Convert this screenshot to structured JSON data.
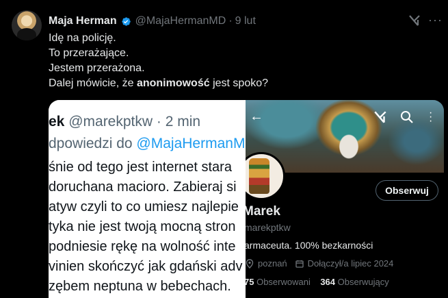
{
  "tweet": {
    "author_name": "Maja Herman",
    "handle": "@MajaHermanMD",
    "separator": "·",
    "date": "9 lut",
    "lines": [
      "Idę na policję.",
      "To przerażające.",
      "Jestem przerażona."
    ],
    "last_line_before": "Dalej mówicie, że ",
    "last_line_bold": "anonimowość",
    "last_line_after": " jest spoko?"
  },
  "left_screenshot": {
    "name": "ek",
    "handle": "@marekptkw",
    "separator": "·",
    "time": "2 min",
    "reply_prefix": "dpowiedzi do ",
    "reply_target": "@MajaHermanM",
    "body_lines": [
      "śnie od tego jest internet stara",
      "doruchana macioro. Zabieraj si",
      "atyw czyli to co umiesz najlepie",
      "tyka nie jest twoją mocną stron",
      "podniesie rękę na wolność inte",
      "vinien skończyć jak gdański adv",
      "zębem neptuna w bebechach."
    ]
  },
  "right_screenshot": {
    "follow_label": "Obserwuj",
    "name": "Marek",
    "handle": "marekptkw",
    "bio": "armaceuta. 100% bezkarności",
    "location": "poznań",
    "joined": "Dołączył/a lipiec 2024",
    "following_count": "75",
    "following_label": "Obserwowani",
    "followers_count": "364",
    "followers_label": "Obserwujący"
  },
  "icons": {
    "verified": "verified-badge-icon",
    "grok": "grok-icon",
    "more": "more-icon",
    "back": "back-arrow-icon",
    "search": "search-icon",
    "location": "location-icon",
    "calendar": "calendar-icon"
  },
  "colors": {
    "background": "#000000",
    "text": "#e7e9ea",
    "muted": "#71767b",
    "link": "#1d9bf0",
    "verified": "#1d9bf0"
  }
}
